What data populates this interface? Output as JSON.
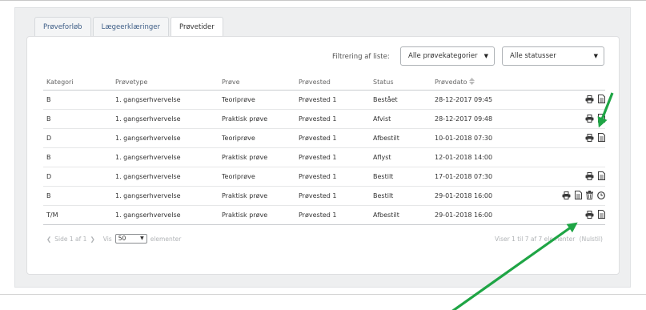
{
  "tabs": [
    {
      "label": "Prøveforløb",
      "active": false
    },
    {
      "label": "Lægeerklæringer",
      "active": false
    },
    {
      "label": "Prøvetider",
      "active": true
    }
  ],
  "filter": {
    "label": "Filtrering af liste:",
    "category_select": "Alle prøvekategorier",
    "status_select": "Alle statusser"
  },
  "table": {
    "columns": [
      "Kategori",
      "Prøvetype",
      "Prøve",
      "Prøvested",
      "Status",
      "Prøvedato"
    ],
    "rows": [
      {
        "kategori": "B",
        "type": "1. gangserhvervelse",
        "prove": "Teoriprøve",
        "sted": "Prøvested 1",
        "status": "Bestået",
        "dato": "28-12-2017 09:45"
      },
      {
        "kategori": "B",
        "type": "1. gangserhvervelse",
        "prove": "Praktisk prøve",
        "sted": "Prøvested 1",
        "status": "Afvist",
        "dato": "28-12-2017 09:48"
      },
      {
        "kategori": "D",
        "type": "1. gangserhvervelse",
        "prove": "Teoriprøve",
        "sted": "Prøvested 1",
        "status": "Afbestilt",
        "dato": "10-01-2018 07:30"
      },
      {
        "kategori": "B",
        "type": "1. gangserhvervelse",
        "prove": "Praktisk prøve",
        "sted": "Prøvested 1",
        "status": "Aflyst",
        "dato": "12-01-2018 14:00"
      },
      {
        "kategori": "D",
        "type": "1. gangserhvervelse",
        "prove": "Teoriprøve",
        "sted": "Prøvested 1",
        "status": "Bestilt",
        "dato": "17-01-2018 07:30"
      },
      {
        "kategori": "B",
        "type": "1. gangserhvervelse",
        "prove": "Praktisk prøve",
        "sted": "Prøvested 1",
        "status": "Bestilt",
        "dato": "29-01-2018 16:00"
      },
      {
        "kategori": "T/M",
        "type": "1. gangserhvervelse",
        "prove": "Praktisk prøve",
        "sted": "Prøvested 1",
        "status": "Afbestilt",
        "dato": "29-01-2018 16:00"
      }
    ]
  },
  "row_actions": [
    [
      "print-icon",
      "document-icon"
    ],
    [
      "print-icon",
      "document-icon"
    ],
    [
      "print-icon",
      "document-icon"
    ],
    [],
    [
      "print-icon",
      "document-icon"
    ],
    [
      "print-icon",
      "document-icon",
      "trash-icon",
      "clock-icon"
    ],
    [
      "print-icon",
      "document-icon"
    ]
  ],
  "pager": {
    "prev": "Side 1 af 1",
    "show_label": "Vis",
    "page_size": "50",
    "items_label": "elementer"
  },
  "summary": {
    "text": "Viser 1 til 7 af 7 elementer",
    "reset": "(Nulstil)"
  },
  "colors": {
    "accent_link": "#3d5d86",
    "arrow": "#1fa545",
    "icon": "#3a3a3a"
  }
}
